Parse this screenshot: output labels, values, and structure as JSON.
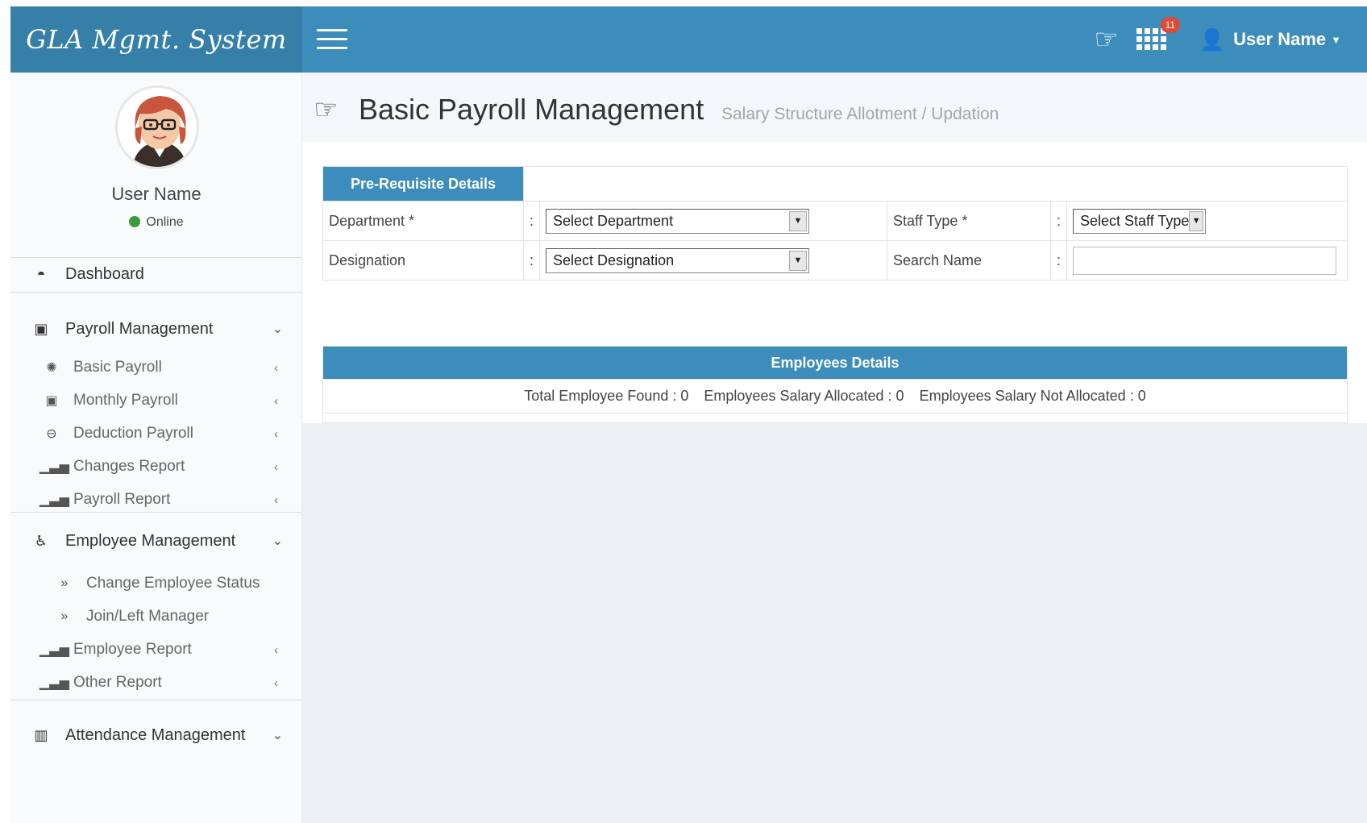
{
  "header": {
    "brand": "GLA Mgmt. System",
    "notification_count": "11",
    "user_name": "User Name"
  },
  "sidebar": {
    "user_name": "User Name",
    "status": "Online",
    "dashboard": "Dashboard",
    "payroll_management": {
      "label": "Payroll Management",
      "items": [
        {
          "label": "Basic Payroll",
          "icon": "gear-icon"
        },
        {
          "label": "Monthly Payroll",
          "icon": "money-icon"
        },
        {
          "label": "Deduction Payroll",
          "icon": "minus-circle-icon"
        },
        {
          "label": "Changes Report",
          "icon": "signal-icon"
        },
        {
          "label": "Payroll Report",
          "icon": "signal-icon"
        }
      ]
    },
    "employee_management": {
      "label": "Employee Management",
      "items": [
        {
          "label": "Change Employee Status",
          "icon": "double-chevron-icon"
        },
        {
          "label": "Join/Left Manager",
          "icon": "double-chevron-icon"
        },
        {
          "label": "Employee Report",
          "icon": "signal-icon"
        },
        {
          "label": "Other Report",
          "icon": "signal-icon"
        }
      ]
    },
    "attendance_management": "Attendance Management"
  },
  "page": {
    "title": "Basic Payroll Management",
    "subtitle": "Salary Structure Allotment / Updation"
  },
  "prereq": {
    "heading": "Pre-Requisite Details",
    "department_label": "Department *",
    "department_value": "Select Department",
    "staff_type_label": "Staff Type *",
    "staff_type_value": "Select Staff Type",
    "designation_label": "Designation",
    "designation_value": "Select Designation",
    "search_name_label": "Search Name",
    "search_name_value": "",
    "colon": ":"
  },
  "employees": {
    "heading": "Employees Details",
    "total_found": "Total Employee Found : 0",
    "allocated": "Employees Salary Allocated : 0",
    "not_allocated": "Employees Salary Not Allocated : 0"
  },
  "colors": {
    "primary": "#3c8dbc",
    "brand_bg": "#367fa9",
    "badge": "#dd4b39",
    "online": "#3c9a3c"
  }
}
